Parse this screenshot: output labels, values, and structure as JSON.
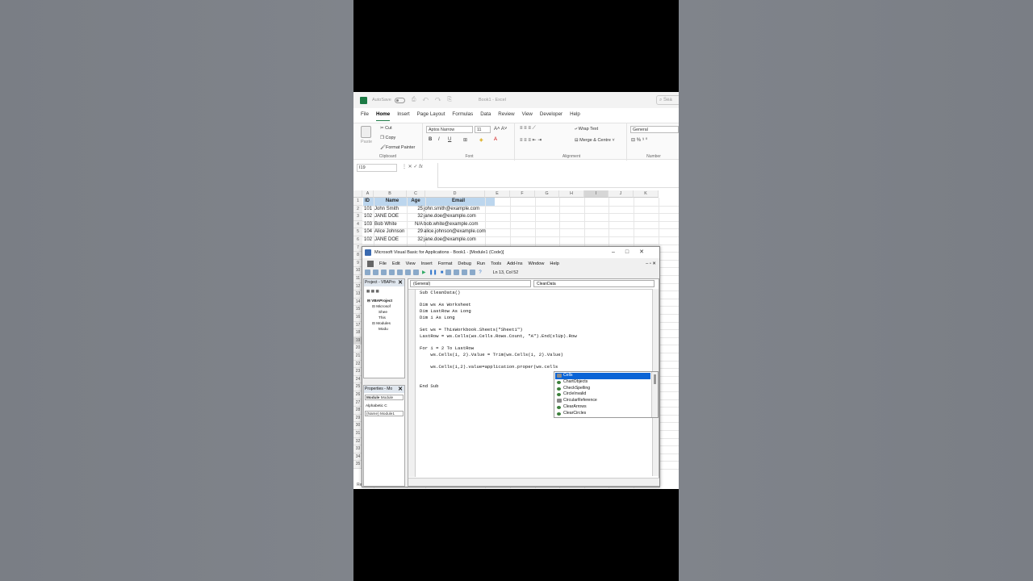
{
  "excel": {
    "autosave_label": "AutoSave",
    "book_title": "Book1 - Excel",
    "search_placeholder": "Sea",
    "tabs": [
      "File",
      "Home",
      "Insert",
      "Page Layout",
      "Formulas",
      "Data",
      "Review",
      "View",
      "Developer",
      "Help"
    ],
    "active_tab": "Home",
    "ribbon": {
      "paste": "Paste",
      "cut": "Cut",
      "copy": "Copy",
      "format_painter": "Format Painter",
      "clipboard": "Clipboard",
      "font_name": "Aptos Narrow",
      "font_size": "11",
      "font": "Font",
      "bold": "B",
      "italic": "I",
      "underline": "U",
      "wrap_text": "Wrap Text",
      "merge_centre": "Merge & Centre",
      "alignment": "Alignment",
      "number_format": "General",
      "number": "Number"
    },
    "name_box": "I19",
    "formula_value": "",
    "columns": [
      "A",
      "B",
      "C",
      "D",
      "E",
      "F",
      "G",
      "H",
      "I",
      "J",
      "K"
    ],
    "rows": [
      "1",
      "2",
      "3",
      "4",
      "5",
      "6",
      "7",
      "8",
      "9",
      "10",
      "11",
      "12",
      "13",
      "14",
      "15",
      "16",
      "17",
      "18",
      "19",
      "20",
      "21",
      "22",
      "23",
      "24",
      "25",
      "26",
      "27",
      "28",
      "29",
      "30",
      "31",
      "32",
      "33",
      "34",
      "35"
    ],
    "headers": [
      "ID",
      "Name",
      "Age",
      "Email"
    ],
    "data": [
      [
        "101",
        "John Smith",
        "25",
        "john.smith@example.com"
      ],
      [
        "102",
        "JANE DOE",
        "32",
        "jane.doe@example.com"
      ],
      [
        "103",
        "Bob White",
        "N/A",
        "bob.white@example.com"
      ],
      [
        "104",
        "Alice Johnson",
        "29",
        "alice.johnson@example.com"
      ],
      [
        "102",
        "JANE DOE",
        "32",
        "jane.doe@example.com"
      ]
    ],
    "status": "Re"
  },
  "vba": {
    "title": "Microsoft Visual Basic for Applications - Book1 - [Module1 (Code)]",
    "menu": [
      "File",
      "Edit",
      "View",
      "Insert",
      "Format",
      "Debug",
      "Run",
      "Tools",
      "Add-Ins",
      "Window",
      "Help"
    ],
    "cursor_pos": "Ln 13, Col 52",
    "project_title": "Project - VBAPro",
    "tree": [
      "VBAProject",
      "Microsof",
      "Shee",
      "This",
      "Modules",
      "Modu"
    ],
    "properties_title": "Properties - Mo",
    "prop_object": "Module",
    "prop_object_type": "Module",
    "prop_tab": "Alphabetic",
    "prop_tab2": "C",
    "prop_name_key": "(Name)",
    "prop_name_val": "Module1",
    "combo_general": "(General)",
    "combo_proc": "CleanData",
    "code": "Sub CleanData()\n\nDim ws As Worksheet\nDim LastRow As Long\nDim i As Long\n\nSet ws = ThisWorkbook.Sheets(\"Sheet1\")\nLastRow = ws.Cells(ws.Cells.Rows.Count, \"A\").End(xlUp).Row\n\nFor i = 2 To LastRow\n    ws.Cells(i, 2).Value = Trim(ws.Cells(i, 2).Value)\n\n    ws.Cells(i,2).value=application.proper(ws.cells\n\n\nEnd Sub",
    "autocomplete": [
      "Cells",
      "ChartObjects",
      "CheckSpelling",
      "CircleInvalid",
      "CircularReference",
      "ClearArrows",
      "ClearCircles"
    ],
    "autocomplete_selected": 0
  }
}
